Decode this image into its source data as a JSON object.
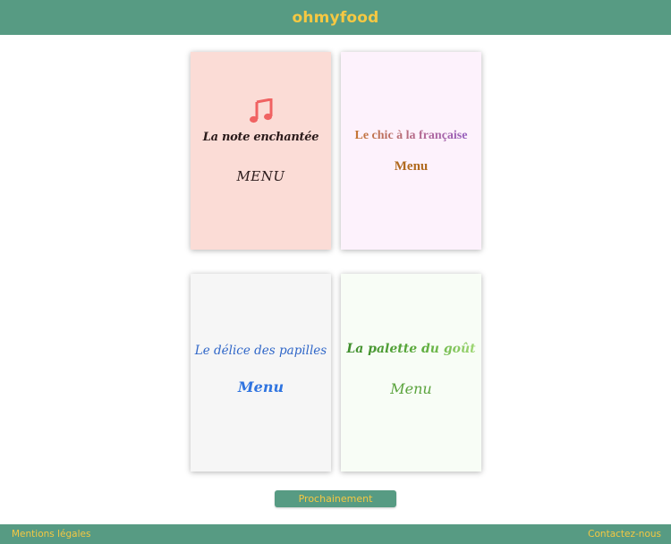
{
  "header": {
    "logo": "ohmyfood"
  },
  "cards": [
    {
      "title": "La note enchantée",
      "menu": "MENU",
      "icon": "music-note-icon",
      "background": "#fbdcd6",
      "icon_color": "#f06262"
    },
    {
      "title": "Le chic à la française",
      "menu": "Menu",
      "background": "#fdf2fc"
    },
    {
      "title": "Le délice des papilles",
      "menu": "Menu",
      "background": "#f6f6f6"
    },
    {
      "title": "La palette du goût",
      "menu": "Menu",
      "background": "#f8fdf6"
    }
  ],
  "soon_button": {
    "label": "Prochainement"
  },
  "footer": {
    "legal": "Mentions légales",
    "contact": "Contactez-nous"
  },
  "colors": {
    "primary": "#579b83",
    "accent": "#f5c842"
  }
}
